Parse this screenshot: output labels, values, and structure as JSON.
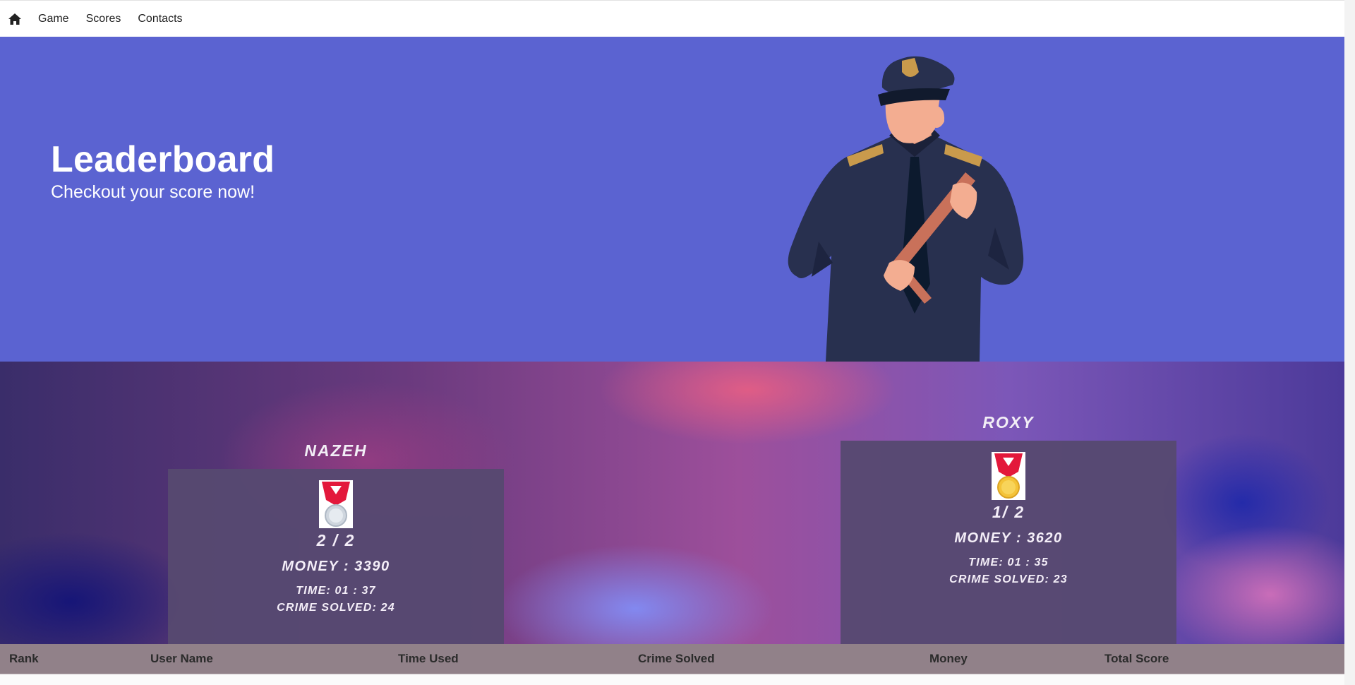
{
  "nav": {
    "home_icon": "home-icon",
    "links": [
      "Game",
      "Scores",
      "Contacts"
    ]
  },
  "hero": {
    "title": "Leaderboard",
    "subtitle": "Checkout your score now!",
    "background_color": "#5b63d1",
    "illustration": "police-officer-with-baton"
  },
  "podium": {
    "players": [
      {
        "name": "NAZEH",
        "medal": "silver-medal-icon",
        "rank": "2 / 2",
        "money": "MONEY : 3390",
        "time": "TIME: 01 : 37",
        "crime_solved": "CRIME SOLVED: 24"
      },
      {
        "name": "ROXY",
        "medal": "gold-medal-icon",
        "rank": "1/ 2",
        "money": "MONEY : 3620",
        "time": "TIME: 01 : 35",
        "crime_solved": "CRIME SOLVED: 23"
      }
    ]
  },
  "table": {
    "headers": [
      "Rank",
      "User Name",
      "Time Used",
      "Crime Solved",
      "Money",
      "Total Score"
    ],
    "header_background": "#918189"
  }
}
